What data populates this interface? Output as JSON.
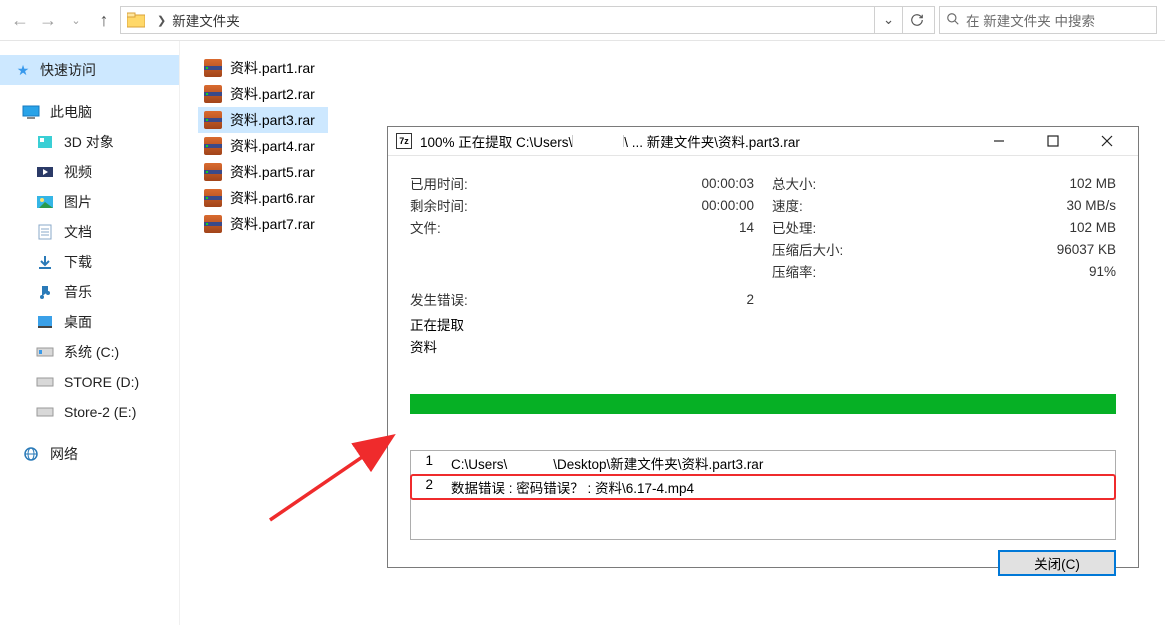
{
  "addr": {
    "folder_name": "新建文件夹",
    "search_placeholder": "在 新建文件夹 中搜索"
  },
  "sidebar": {
    "quick": "快速访问",
    "this_pc": "此电脑",
    "items": [
      "3D 对象",
      "视频",
      "图片",
      "文档",
      "下载",
      "音乐",
      "桌面",
      "系统 (C:)",
      "STORE (D:)",
      "Store-2 (E:)"
    ],
    "network": "网络"
  },
  "files": [
    "资料.part1.rar",
    "资料.part2.rar",
    "资料.part3.rar",
    "资料.part4.rar",
    "资料.part5.rar",
    "资料.part6.rar",
    "资料.part7.rar"
  ],
  "selected_file_index": 2,
  "dialog": {
    "title_prefix": "100% 正在提取 C:\\Users\\",
    "title_suffix": "\\ ... 新建文件夹\\资料.part3.rar",
    "stats_left": [
      {
        "lab": "已用时间:",
        "val": "00:00:03"
      },
      {
        "lab": "剩余时间:",
        "val": "00:00:00"
      },
      {
        "lab": "文件:",
        "val": "14"
      }
    ],
    "stats_right": [
      {
        "lab": "总大小:",
        "val": "102 MB"
      },
      {
        "lab": "速度:",
        "val": "30 MB/s"
      },
      {
        "lab": "已处理:",
        "val": "102 MB"
      },
      {
        "lab": "压缩后大小:",
        "val": "96037 KB"
      },
      {
        "lab": "压缩率:",
        "val": "91%"
      }
    ],
    "err_count_label": "发生错误:",
    "err_count": "2",
    "extracting_label": "正在提取",
    "extracting_name": "资料",
    "log": [
      {
        "n": "1",
        "prefix": "C:\\Users\\",
        "suffix": "\\Desktop\\新建文件夹\\资料.part3.rar",
        "err": false
      },
      {
        "n": "2",
        "text": "数据错误 : 密码错误？ : 资料\\6.17-4.mp4",
        "err": true
      }
    ],
    "close_btn": "关闭(C)"
  }
}
